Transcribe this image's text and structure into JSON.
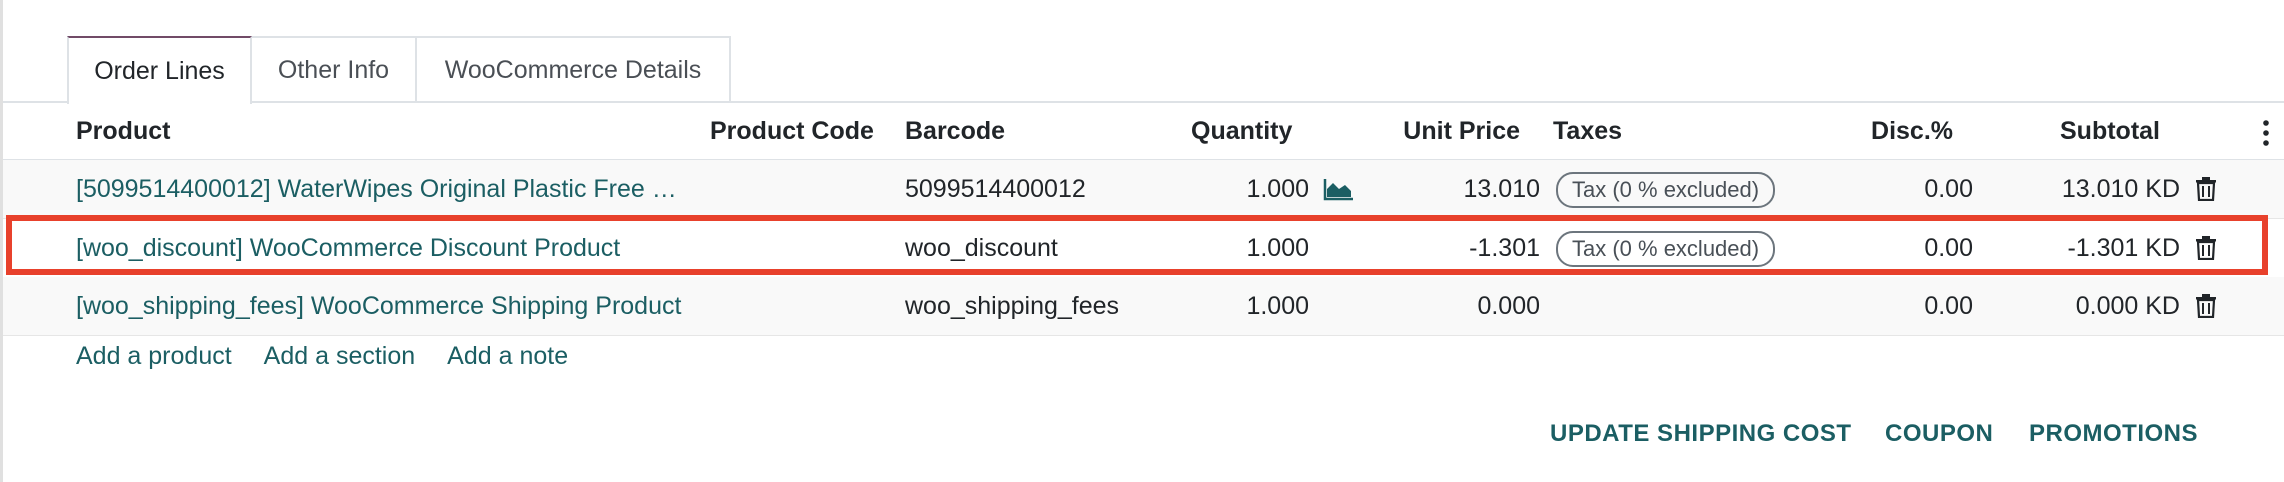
{
  "tabs": [
    {
      "label": "Order Lines"
    },
    {
      "label": "Other Info"
    },
    {
      "label": "WooCommerce Details"
    }
  ],
  "columns": {
    "product": "Product",
    "product_code": "Product Code",
    "barcode": "Barcode",
    "quantity": "Quantity",
    "unit_price": "Unit Price",
    "taxes": "Taxes",
    "discount": "Disc.%",
    "subtotal": "Subtotal"
  },
  "rows": [
    {
      "product": "[5099514400012] WaterWipes Original Plastic Free Wipes",
      "product_code": "",
      "barcode": "5099514400012",
      "quantity": "1.000",
      "unit_price": "13.010",
      "tax": "Tax (0 % excluded)",
      "discount": "0.00",
      "subtotal": "13.010 KD"
    },
    {
      "product": "[woo_discount] WooCommerce Discount Product",
      "product_code": "",
      "barcode": "woo_discount",
      "quantity": "1.000",
      "unit_price": "-1.301",
      "tax": "Tax (0 % excluded)",
      "discount": "0.00",
      "subtotal": "-1.301 KD"
    },
    {
      "product": "[woo_shipping_fees] WooCommerce Shipping Product",
      "product_code": "",
      "barcode": "woo_shipping_fees",
      "quantity": "1.000",
      "unit_price": "0.000",
      "tax": "",
      "discount": "0.00",
      "subtotal": "0.000 KD"
    }
  ],
  "add_links": {
    "product": "Add a product",
    "section": "Add a section",
    "note": "Add a note"
  },
  "actions": {
    "update_shipping": "UPDATE SHIPPING COST",
    "coupon": "COUPON",
    "promotions": "PROMOTIONS"
  },
  "colors": {
    "link": "#1b5e63",
    "highlight": "#e8412c",
    "tab_accent": "#714b67"
  }
}
